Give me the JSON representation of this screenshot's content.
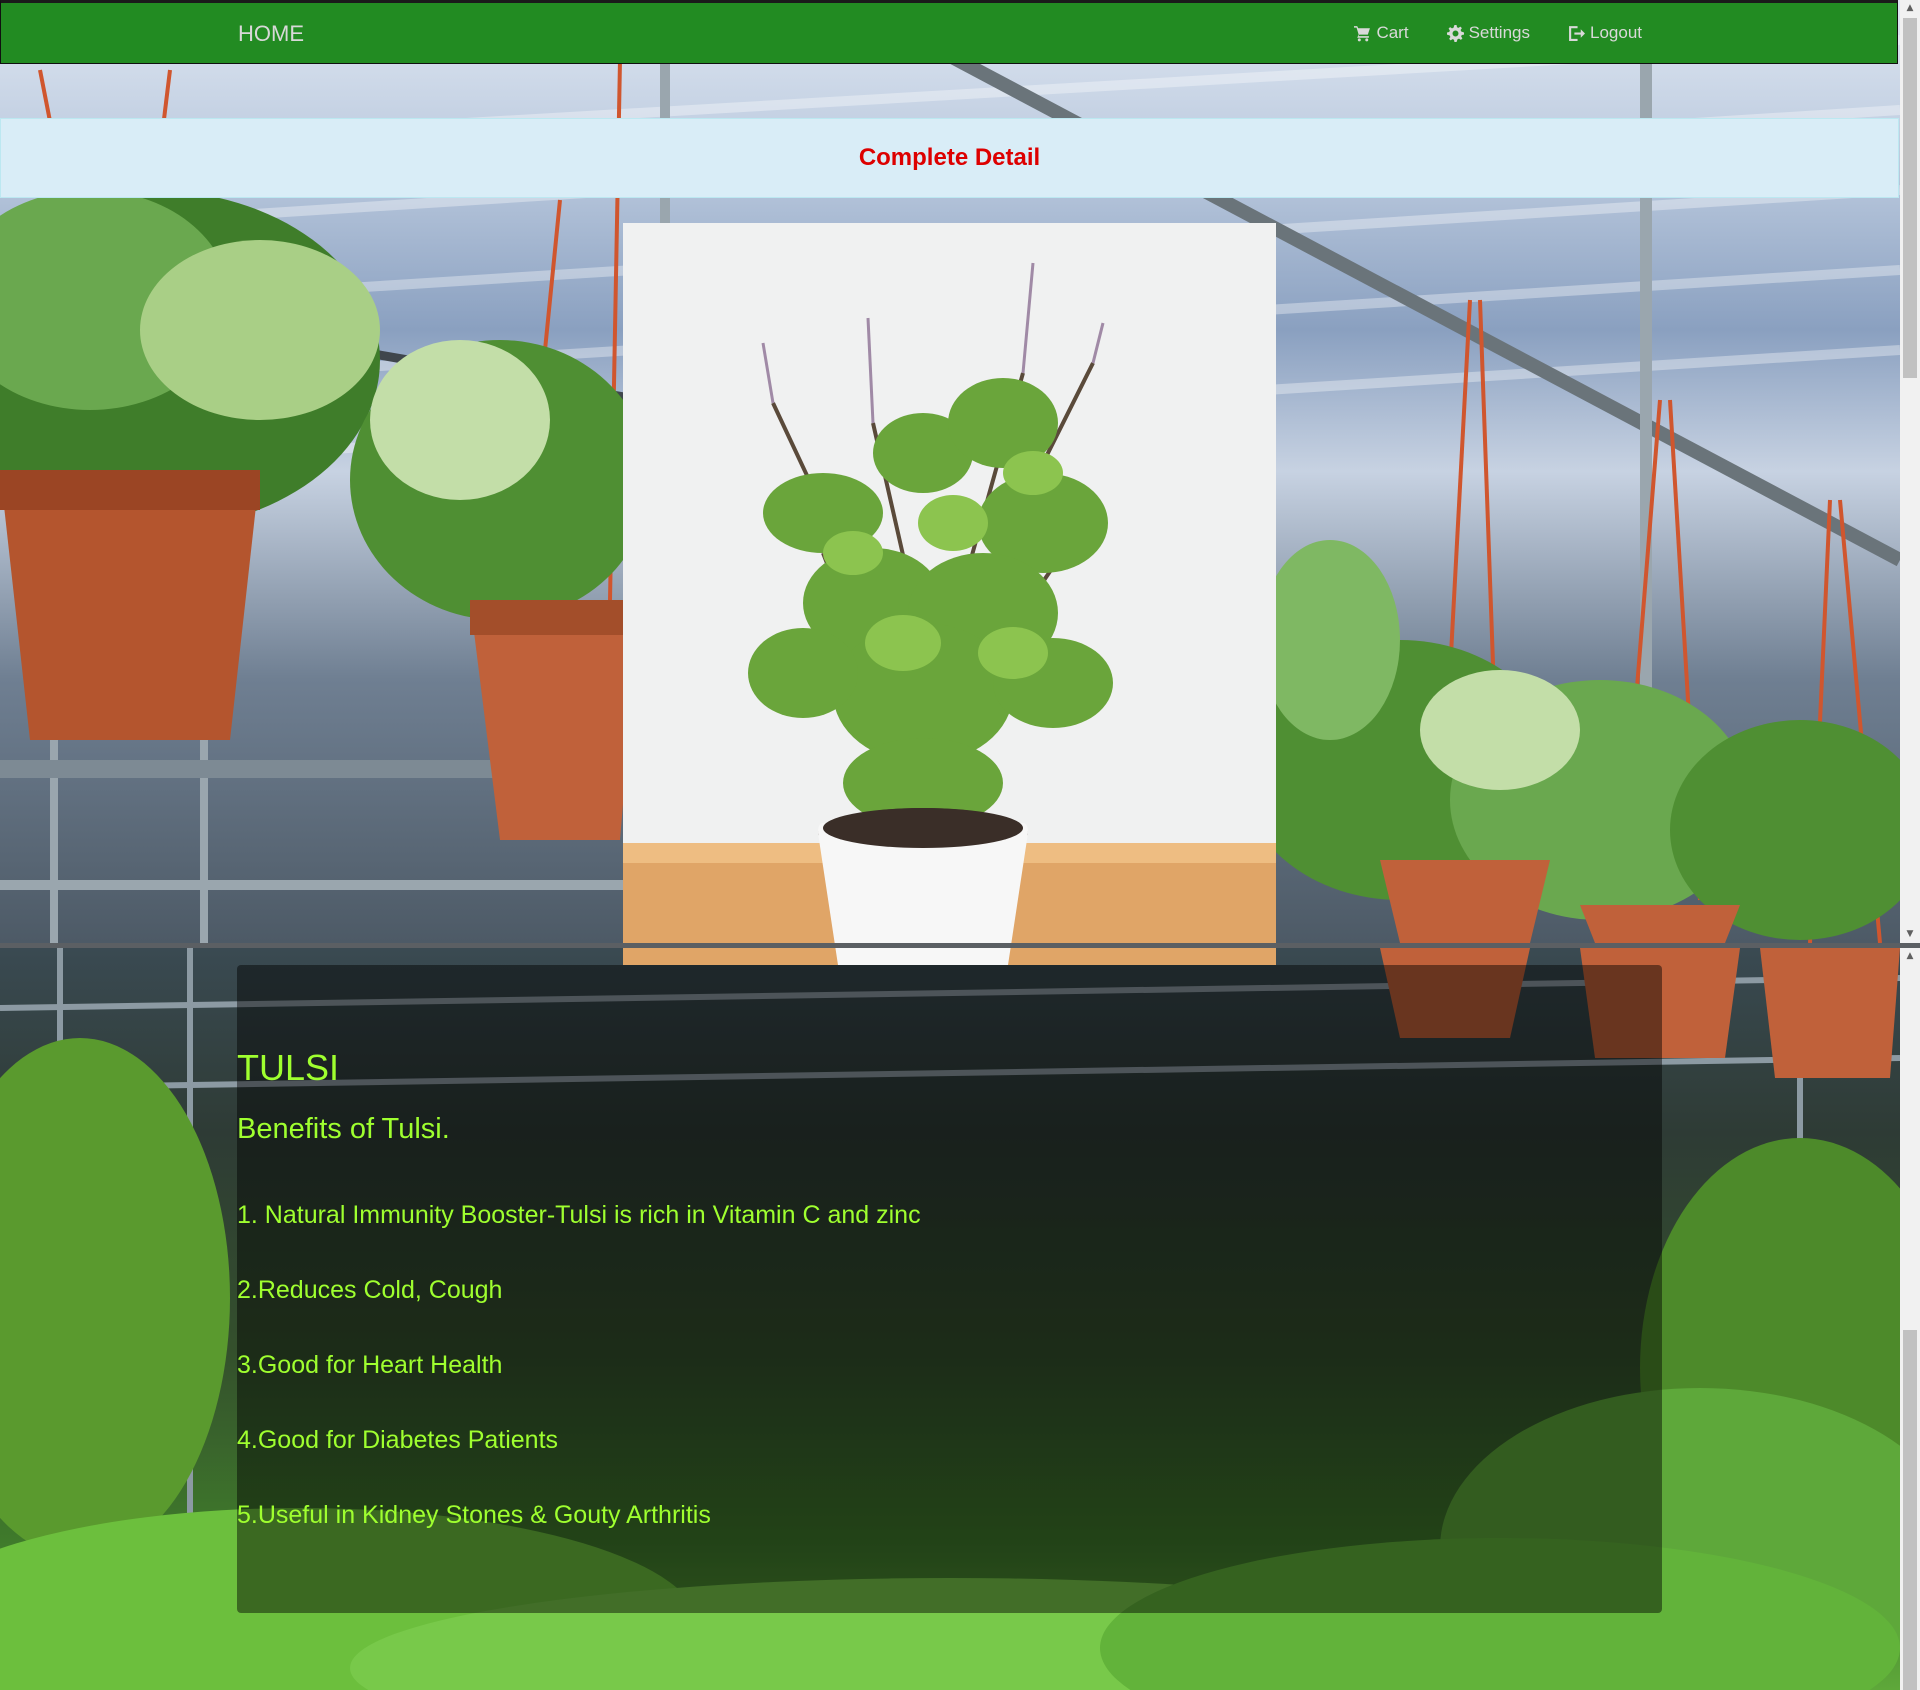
{
  "navbar": {
    "brand": "HOME",
    "links": [
      {
        "label": "Cart",
        "icon": "shopping-cart-icon"
      },
      {
        "label": "Settings",
        "icon": "gear-icon"
      },
      {
        "label": "Logout",
        "icon": "logout-icon"
      }
    ],
    "background_color": "#228b22"
  },
  "detail_header": {
    "title": "Complete Detail",
    "title_color": "#dd0000",
    "background_color": "#d9edf7"
  },
  "product": {
    "name": "TULSI",
    "benefits_heading": "Benefits of Tulsi.",
    "benefits": [
      "1. Natural Immunity Booster-Tulsi is rich in Vitamin C and zinc",
      "2.Reduces Cold, Cough",
      "3.Good for Heart Health",
      "4.Good for Diabetes Patients",
      "5.Useful in Kidney Stones & Gouty Arthritis"
    ],
    "text_color": "#9fff2f"
  }
}
